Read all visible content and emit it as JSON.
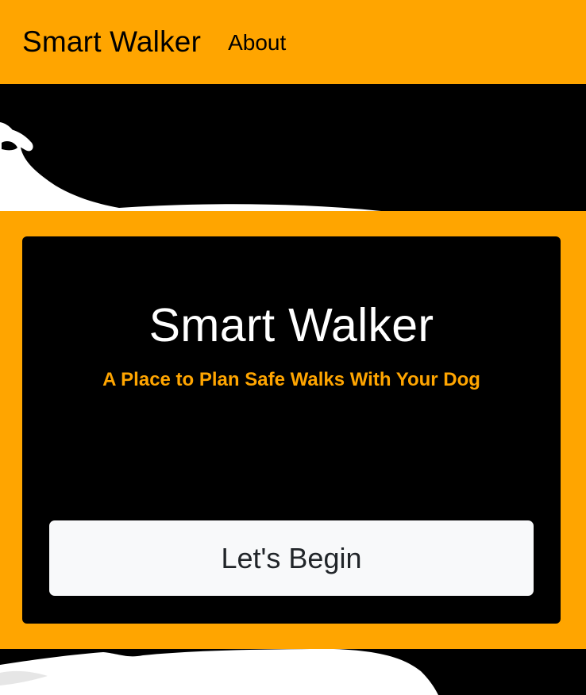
{
  "navbar": {
    "brand": "Smart Walker",
    "links": [
      {
        "label": "About"
      }
    ]
  },
  "hero": {
    "title": "Smart Walker",
    "subtitle": "A Place to Plan Safe Walks With Your Dog",
    "cta_label": "Let's Begin"
  },
  "colors": {
    "accent": "#ffa500",
    "card_background": "#000000",
    "button_background": "#f8f9fa",
    "button_text": "#212529"
  },
  "background_image": "dog-silhouette-image"
}
